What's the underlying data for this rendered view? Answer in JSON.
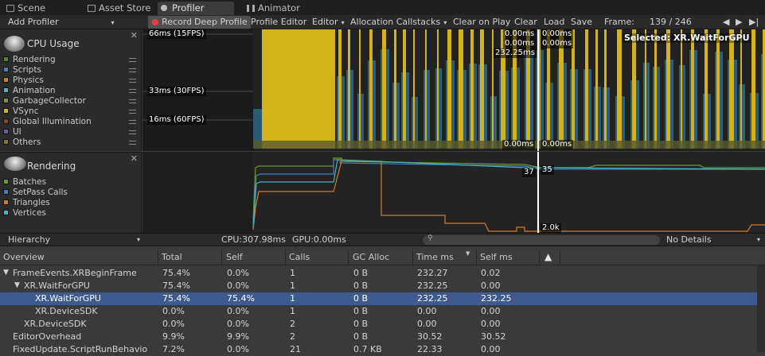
{
  "tabs": [
    {
      "label": "Scene",
      "icon": "scene-icon",
      "active": false
    },
    {
      "label": "Asset Store",
      "icon": "store-icon",
      "active": false
    },
    {
      "label": "Profiler",
      "icon": "profiler-icon",
      "active": true
    },
    {
      "label": "Animator",
      "icon": "animator-icon",
      "active": false
    }
  ],
  "toolbar": {
    "add_profiler": "Add Profiler",
    "record": "Record",
    "deep_profile": "Deep Profile",
    "profile_editor": "Profile Editor",
    "editor": "Editor",
    "allocation_callstacks": "Allocation Callstacks",
    "clear_on_play": "Clear on Play",
    "clear": "Clear",
    "load": "Load",
    "save": "Save",
    "frame_label": "Frame:",
    "frame_value": "139 / 246"
  },
  "cpu_panel": {
    "title": "CPU Usage",
    "legend": [
      {
        "label": "Rendering",
        "color": "#4b8c2c"
      },
      {
        "label": "Scripts",
        "color": "#3f7fc0"
      },
      {
        "label": "Physics",
        "color": "#d67a21"
      },
      {
        "label": "Animation",
        "color": "#3fb7c7"
      },
      {
        "label": "GarbageCollector",
        "color": "#8a8a3a"
      },
      {
        "label": "VSync",
        "color": "#d4b21a"
      },
      {
        "label": "Global Illumination",
        "color": "#8a3e2a"
      },
      {
        "label": "UI",
        "color": "#6a5aa8"
      },
      {
        "label": "Others",
        "color": "#7a7a2a"
      }
    ],
    "y_labels": [
      "66ms (15FPS)",
      "33ms (30FPS)",
      "16ms (60FPS)"
    ],
    "selected_label": "Selected: XR.WaitForGPU",
    "cursor_values_top": [
      "0.00ms",
      "0.00ms",
      "232.25ms"
    ],
    "cursor_values_right": [
      "0.00ms",
      "0.00ms"
    ],
    "cursor_bottom_left": "0.00ms",
    "cursor_bottom_right": "0.00ms"
  },
  "rendering_panel": {
    "title": "Rendering",
    "legend": [
      {
        "label": "Batches",
        "color": "#6a9a2a"
      },
      {
        "label": "SetPass Calls",
        "color": "#3f7fc0"
      },
      {
        "label": "Triangles",
        "color": "#d67a21"
      },
      {
        "label": "Vertices",
        "color": "#3fb7c7"
      }
    ],
    "cursor_labels": [
      "37",
      "35",
      "2.0k"
    ]
  },
  "infobar": {
    "view_mode": "Hierarchy",
    "cpu": "CPU:307.98ms",
    "gpu": "GPU:0.00ms",
    "search_placeholder": "",
    "details": "No Details"
  },
  "table": {
    "columns": [
      "Overview",
      "Total",
      "Self",
      "Calls",
      "GC Alloc",
      "Time ms",
      "Self ms"
    ],
    "rows": [
      {
        "name": "FrameEvents.XRBeginFrame",
        "indent": 0,
        "arrow": "down",
        "total": "75.4%",
        "self": "0.0%",
        "calls": "1",
        "gc": "0 B",
        "time": "232.27",
        "selfms": "0.02",
        "selected": false
      },
      {
        "name": "XR.WaitForGPU",
        "indent": 1,
        "arrow": "down",
        "total": "75.4%",
        "self": "0.0%",
        "calls": "1",
        "gc": "0 B",
        "time": "232.25",
        "selfms": "0.00",
        "selected": false
      },
      {
        "name": "XR.WaitForGPU",
        "indent": 2,
        "arrow": "",
        "total": "75.4%",
        "self": "75.4%",
        "calls": "1",
        "gc": "0 B",
        "time": "232.25",
        "selfms": "232.25",
        "selected": true
      },
      {
        "name": "XR.DeviceSDK",
        "indent": 2,
        "arrow": "",
        "total": "0.0%",
        "self": "0.0%",
        "calls": "1",
        "gc": "0 B",
        "time": "0.00",
        "selfms": "0.00",
        "selected": false
      },
      {
        "name": "XR.DeviceSDK",
        "indent": 1,
        "arrow": "",
        "total": "0.0%",
        "self": "0.0%",
        "calls": "2",
        "gc": "0 B",
        "time": "0.00",
        "selfms": "0.00",
        "selected": false
      },
      {
        "name": "EditorOverhead",
        "indent": 0,
        "arrow": "",
        "total": "9.9%",
        "self": "9.9%",
        "calls": "2",
        "gc": "0 B",
        "time": "30.52",
        "selfms": "30.52",
        "selected": false
      },
      {
        "name": "FixedUpdate.ScriptRunBehavio",
        "indent": 0,
        "arrow": "",
        "total": "7.2%",
        "self": "0.0%",
        "calls": "21",
        "gc": "0.7 KB",
        "time": "22.33",
        "selfms": "0.00",
        "selected": false
      }
    ]
  }
}
